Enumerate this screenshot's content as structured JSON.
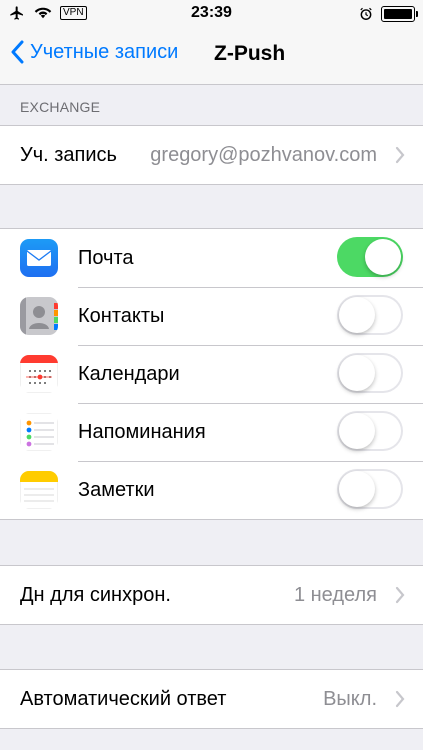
{
  "status": {
    "time": "23:39",
    "vpn": "VPN"
  },
  "nav": {
    "back_label": "Учетные записи",
    "title": "Z-Push"
  },
  "exchange": {
    "header": "EXCHANGE",
    "account_label": "Уч. запись",
    "account_value": "gregory@pozhvanov.com"
  },
  "services": [
    {
      "label": "Почта",
      "enabled": true,
      "icon": "mail-icon"
    },
    {
      "label": "Контакты",
      "enabled": false,
      "icon": "contacts-icon"
    },
    {
      "label": "Календари",
      "enabled": false,
      "icon": "calendar-icon"
    },
    {
      "label": "Напоминания",
      "enabled": false,
      "icon": "reminders-icon"
    },
    {
      "label": "Заметки",
      "enabled": false,
      "icon": "notes-icon"
    }
  ],
  "sync": {
    "label": "Дн для синхрон.",
    "value": "1 неделя"
  },
  "auto_reply": {
    "label": "Автоматический ответ",
    "value": "Выкл."
  },
  "colors": {
    "accent": "#007aff",
    "toggle_on": "#4cd964",
    "background": "#efeff4"
  }
}
